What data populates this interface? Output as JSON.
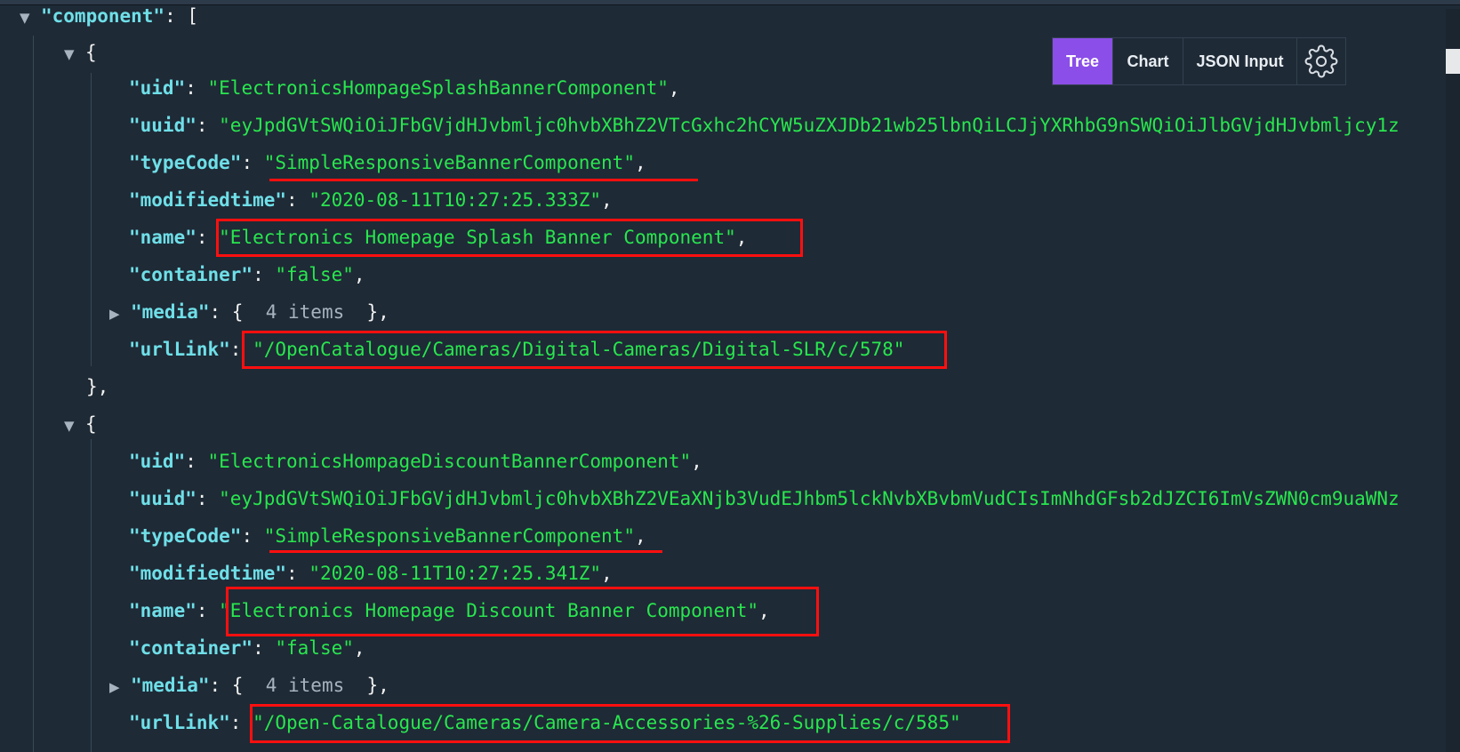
{
  "root": {
    "key": "\"component\"",
    "colon": ": ",
    "bracket": "["
  },
  "toolbar": {
    "tree_label": "Tree",
    "chart_label": "Chart",
    "json_input_label": "JSON Input",
    "settings_icon": "gear-icon"
  },
  "items": [
    {
      "uid_key": "\"uid\"",
      "uid_value": "\"ElectronicsHompageSplashBannerComponent\"",
      "uuid_key": "\"uuid\"",
      "uuid_value": "\"eyJpdGVtSWQiOiJFbGVjdHJvbmljc0hvbXBhZ2VTcGxhc2hCYW5uZXJDb21wb25lbnQiLCJjYXRhbG9nSWQiOiJlbGVjdHJvbmljcy1z",
      "typecode_key": "\"typeCode\"",
      "typecode_value": "\"SimpleResponsiveBannerComponent\"",
      "modified_key": "\"modifiedtime\"",
      "modified_value": "\"2020-08-11T10:27:25.333Z\"",
      "name_key": "\"name\"",
      "name_value": "\"Electronics Homepage Splash Banner Component\"",
      "container_key": "\"container\"",
      "container_value": "\"false\"",
      "media_key": "\"media\"",
      "media_count": "4 items",
      "urllink_key": "\"urlLink\"",
      "urllink_value": "\"/OpenCatalogue/Cameras/Digital-Cameras/Digital-SLR/c/578\""
    },
    {
      "uid_key": "\"uid\"",
      "uid_value": "\"ElectronicsHompageDiscountBannerComponent\"",
      "uuid_key": "\"uuid\"",
      "uuid_value": "\"eyJpdGVtSWQiOiJFbGVjdHJvbmljc0hvbXBhZ2VEaXNjb3VudEJhbm5lckNvbXBvbmVudCIsImNhdGFsb2dJZCI6ImVsZWN0cm9uaWNz",
      "typecode_key": "\"typeCode\"",
      "typecode_value": "\"SimpleResponsiveBannerComponent\"",
      "modified_key": "\"modifiedtime\"",
      "modified_value": "\"2020-08-11T10:27:25.341Z\"",
      "name_key": "\"name\"",
      "name_value": "\"Electronics Homepage Discount Banner Component\"",
      "container_key": "\"container\"",
      "container_value": "\"false\"",
      "media_key": "\"media\"",
      "media_count": "4 items",
      "urllink_key": "\"urlLink\"",
      "urllink_value": "\"/Open-Catalogue/Cameras/Camera-Accessories-%26-Supplies/c/585\""
    }
  ],
  "colors": {
    "background": "#1e2a36",
    "key": "#6fdfe8",
    "string": "#29e64e",
    "active_tab": "#8b4ee8",
    "annotation": "#ff0f0f"
  }
}
